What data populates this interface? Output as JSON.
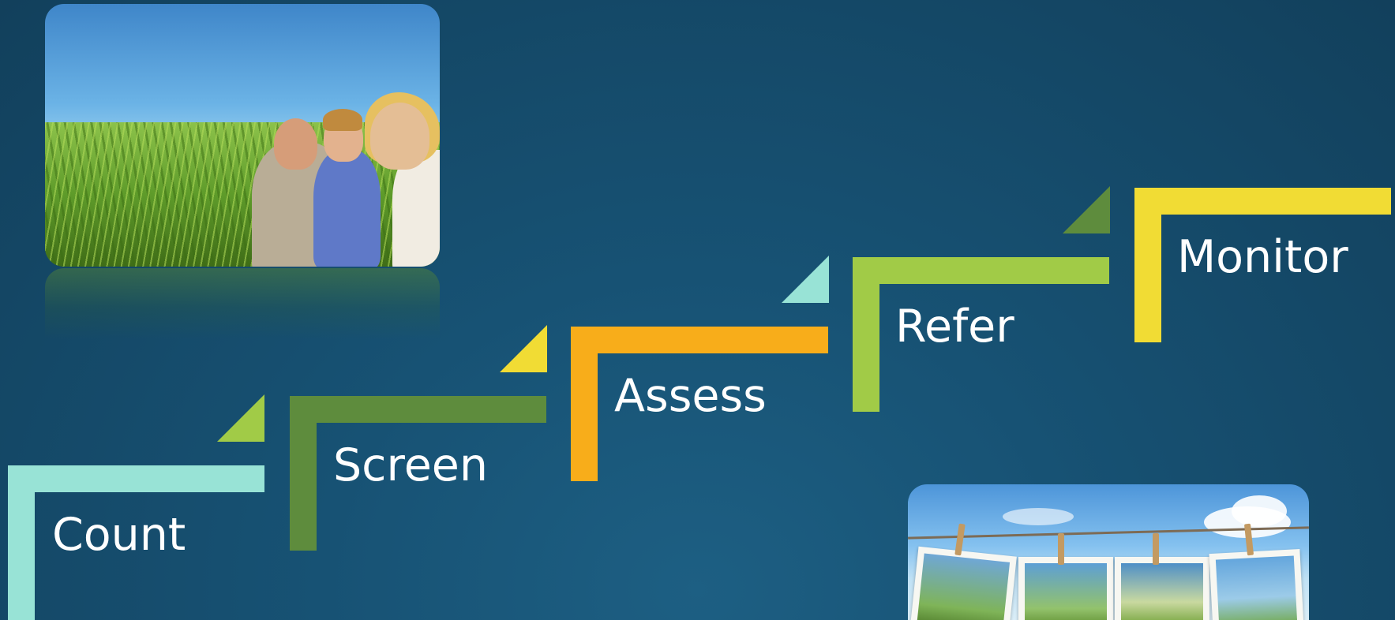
{
  "steps": [
    {
      "label": "Count",
      "color": "#98e3d6"
    },
    {
      "label": "Screen",
      "color": "#5e8c3d"
    },
    {
      "label": "Assess",
      "color": "#f8ad1a"
    },
    {
      "label": "Refer",
      "color": "#a1cb47"
    },
    {
      "label": "Monitor",
      "color": "#f1dc34"
    }
  ],
  "accent_triangles": [
    {
      "color": "#a1cb47"
    },
    {
      "color": "#f1dc34"
    },
    {
      "color": "#98e3d6"
    },
    {
      "color": "#5e8c3d"
    }
  ],
  "background_color": "#175274"
}
